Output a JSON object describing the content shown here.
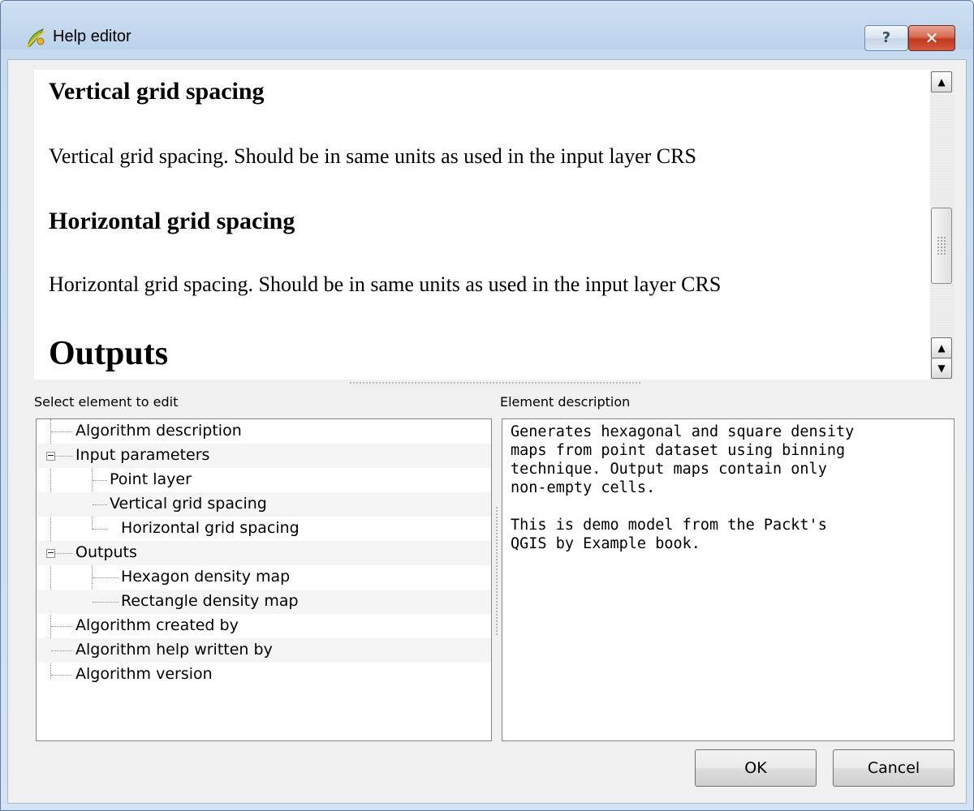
{
  "window": {
    "title": "Help editor",
    "help_button": "?",
    "close_button": "✕"
  },
  "help_view": {
    "sections": [
      {
        "heading": "Vertical grid spacing",
        "text": "Vertical grid spacing. Should be in same units as used in the input layer CRS"
      },
      {
        "heading": "Horizontal grid spacing",
        "text": "Horizontal grid spacing. Should be in same units as used in the input layer CRS"
      }
    ],
    "outputs_heading": "Outputs"
  },
  "tree": {
    "label": "Select element to edit",
    "items": [
      "Algorithm description",
      "Input parameters",
      "Point layer",
      "Vertical grid spacing",
      "Horizontal grid spacing",
      "Outputs",
      "Hexagon density map",
      "Rectangle density map",
      "Algorithm created by",
      "Algorithm help written by",
      "Algorithm version"
    ]
  },
  "description": {
    "label": "Element description",
    "text": "Generates hexagonal and square density\nmaps from point dataset using binning\ntechnique. Output maps contain only\nnon-empty cells.\n\nThis is demo model from the Packt's\nQGIS by Example book."
  },
  "buttons": {
    "ok": "OK",
    "cancel": "Cancel"
  },
  "icons": {
    "app": "qgis-logo-icon",
    "help": "question-mark-icon",
    "close": "close-icon"
  }
}
